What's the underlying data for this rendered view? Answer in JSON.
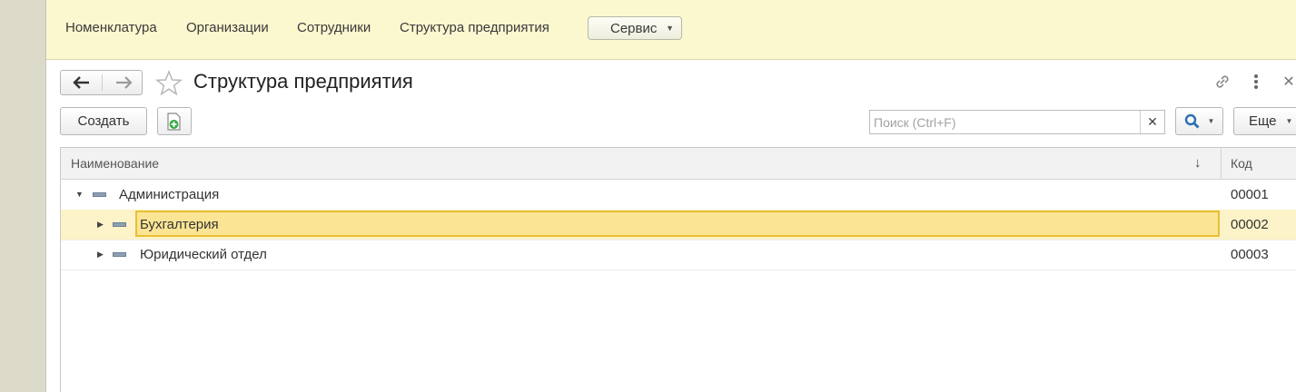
{
  "topnav": {
    "items": [
      "Номенклатура",
      "Организации",
      "Сотрудники",
      "Структура предприятия"
    ],
    "service_label": "Сервис"
  },
  "header": {
    "title": "Структура предприятия"
  },
  "toolbar": {
    "create_label": "Создать",
    "search_placeholder": "Поиск (Ctrl+F)",
    "more_label": "Еще"
  },
  "table": {
    "columns": {
      "name": "Наименование",
      "code": "Код"
    },
    "rows": [
      {
        "name": "Администрация",
        "code": "00001",
        "level": 0,
        "expanded": true,
        "selected": false
      },
      {
        "name": "Бухгалтерия",
        "code": "00002",
        "level": 1,
        "expanded": false,
        "selected": true
      },
      {
        "name": "Юридический отдел",
        "code": "00003",
        "level": 1,
        "expanded": false,
        "selected": false
      }
    ]
  },
  "colors": {
    "top_bar": "#fbf7cf",
    "selection_fill": "#fbe594",
    "selection_border": "#e8bf35",
    "search_icon": "#2a6fb2",
    "add_icon": "#3aa845"
  }
}
